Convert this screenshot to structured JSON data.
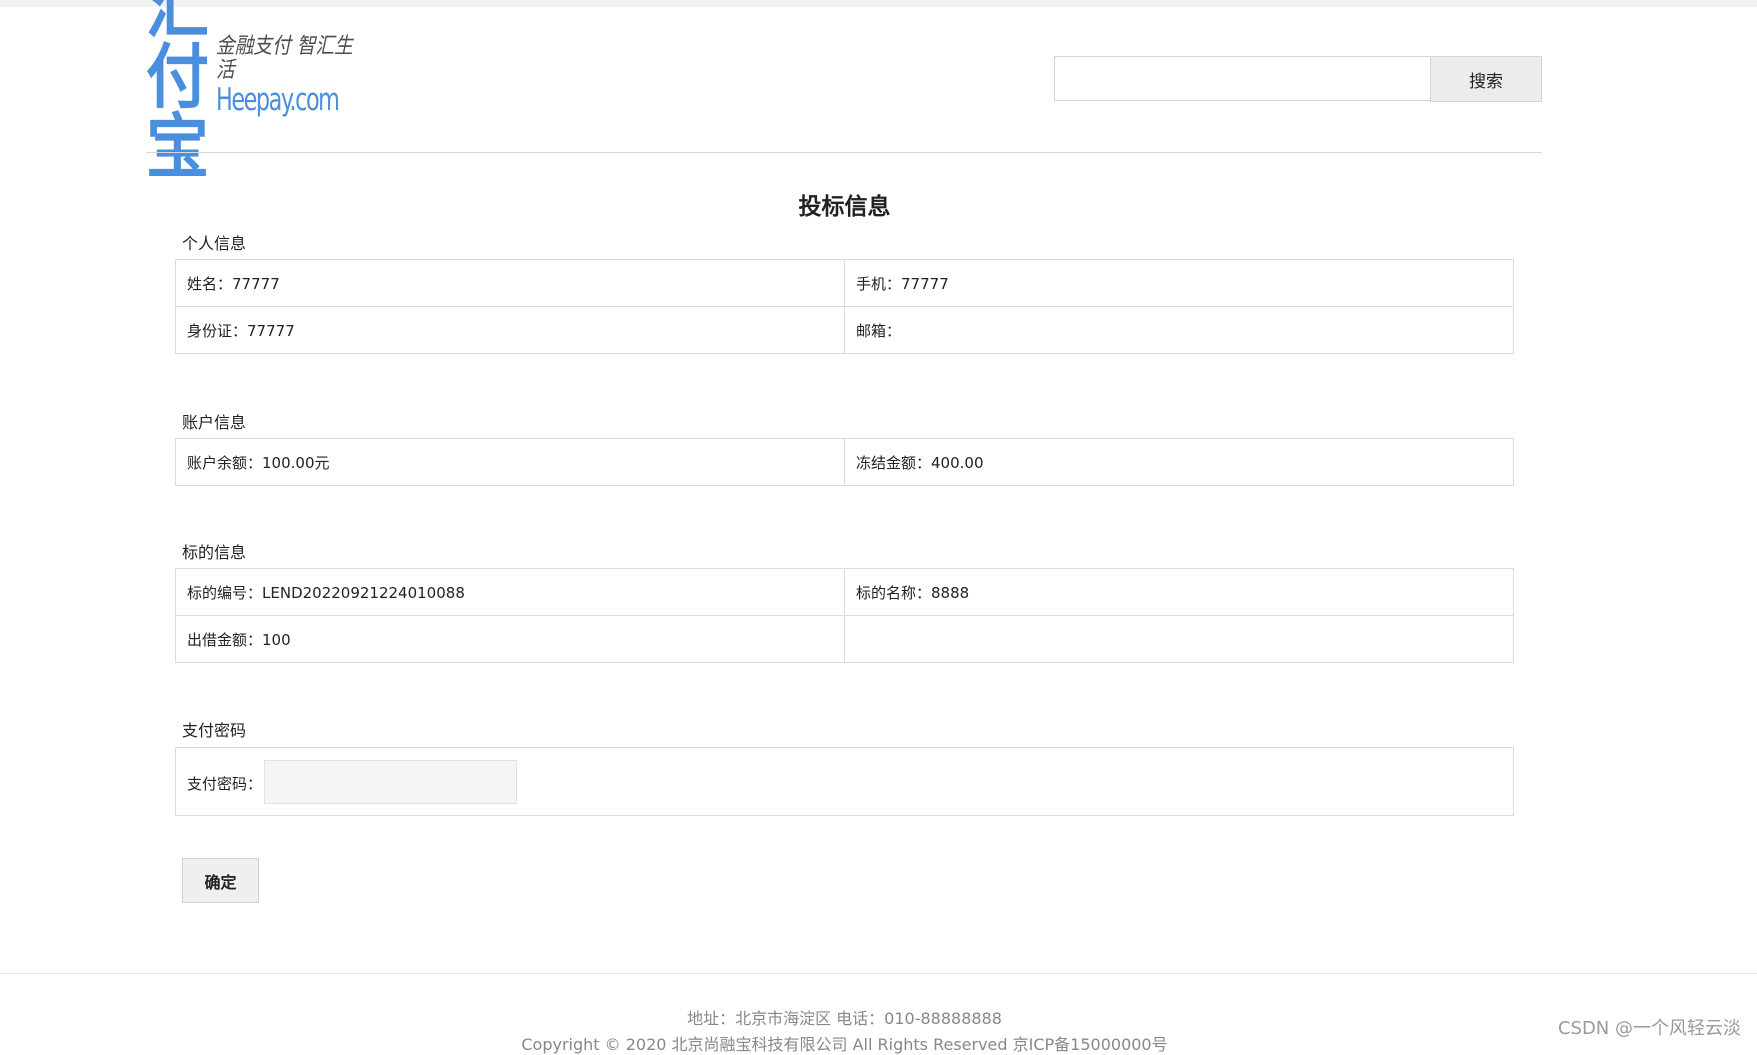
{
  "header": {
    "logo": {
      "name": "汇付宝",
      "slogan": "金融支付 智汇生活",
      "domain": "Heepay.com"
    },
    "search": {
      "value": "",
      "button_label": "搜索"
    }
  },
  "page": {
    "title": "投标信息"
  },
  "sections": {
    "personal": {
      "title": "个人信息",
      "rows": [
        [
          {
            "label": "姓名：",
            "value": "77777"
          },
          {
            "label": "手机：",
            "value": "77777"
          }
        ],
        [
          {
            "label": "身份证：",
            "value": "77777"
          },
          {
            "label": "邮箱：",
            "value": ""
          }
        ]
      ]
    },
    "account": {
      "title": "账户信息",
      "rows": [
        [
          {
            "label": "账户余额：",
            "value": "100.00元"
          },
          {
            "label": "冻结金额：",
            "value": "400.00"
          }
        ]
      ]
    },
    "lend": {
      "title": "标的信息",
      "rows": [
        [
          {
            "label": "标的编号：",
            "value": "LEND20220921224010088"
          },
          {
            "label": "标的名称：",
            "value": "8888"
          }
        ],
        [
          {
            "label": "出借金额：",
            "value": "100"
          },
          {
            "label": "",
            "value": ""
          }
        ]
      ]
    },
    "password": {
      "title": "支付密码",
      "label": "支付密码：",
      "value": ""
    }
  },
  "actions": {
    "confirm_label": "确定"
  },
  "footer": {
    "address": "地址：北京市海淀区 电话：010-88888888",
    "copyright": "Copyright © 2020 北京尚融宝科技有限公司 All Rights Reserved 京ICP备15000000号"
  },
  "watermark": "CSDN @一个风轻云淡",
  "colors": {
    "brand_blue": "#4a8fdd",
    "border": "#dcdcdc",
    "footer_text": "#888888"
  }
}
